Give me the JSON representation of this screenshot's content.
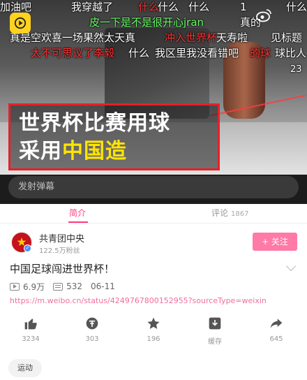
{
  "danmu": [
    {
      "text": "加油吧",
      "color": "white"
    },
    {
      "text": "我穿越了",
      "color": "white"
    },
    {
      "text": "什么",
      "color": "red"
    },
    {
      "text": "什么",
      "color": "white"
    },
    {
      "text": "什么",
      "color": "white"
    },
    {
      "text": "1",
      "color": "white"
    },
    {
      "text": "什么",
      "color": "white"
    },
    {
      "text": "皮一下是不是很开心jran",
      "color": "green"
    },
    {
      "text": "真的",
      "color": "white"
    },
    {
      "text": "真是空欢喜一场果然太天真",
      "color": "white"
    },
    {
      "text": "冲入世界杯",
      "color": "red"
    },
    {
      "text": "天寿啦",
      "color": "white"
    },
    {
      "text": "见标题",
      "color": "white"
    },
    {
      "text": "太不可思议了李毅",
      "color": "red"
    },
    {
      "text": "什么",
      "color": "white"
    },
    {
      "text": "我区里我没看错吧",
      "color": "white"
    },
    {
      "text": "的球",
      "color": "red"
    },
    {
      "text": "球比人",
      "color": "white"
    },
    {
      "text": "23",
      "color": "white"
    }
  ],
  "caption": {
    "line1_white_a": "世界杯",
    "line1_white_b": "比赛用球",
    "line2_white_a": "采用",
    "line2_yellow": "中国造"
  },
  "danmu_input": {
    "placeholder": "发射弹幕"
  },
  "tabs": [
    {
      "label": "简介",
      "active": true
    },
    {
      "label": "评论",
      "count": "1867",
      "active": false
    }
  ],
  "account": {
    "name": "共青团中央",
    "fans": "122.5万粉丝",
    "follow_label": "+ 关注"
  },
  "video": {
    "title": "中国足球闯进世界杯！",
    "plays": "6.9万",
    "danmu_count": "532",
    "date": "06-11",
    "link": "https://m.weibo.cn/status/4249767800152955?sourceType=weixin"
  },
  "actions": [
    {
      "icon": "thumbs-up-icon",
      "label": "3234"
    },
    {
      "icon": "coin-icon",
      "label": "303"
    },
    {
      "icon": "star-icon",
      "label": "196"
    },
    {
      "icon": "download-icon",
      "label": "缓存"
    },
    {
      "icon": "share-icon",
      "label": "645"
    }
  ],
  "tag": "运动",
  "colors": {
    "accent": "#ff3e7f",
    "follow": "#ff7aa6",
    "caption_border": "#e52128",
    "caption_yellow": "#ffe500"
  }
}
